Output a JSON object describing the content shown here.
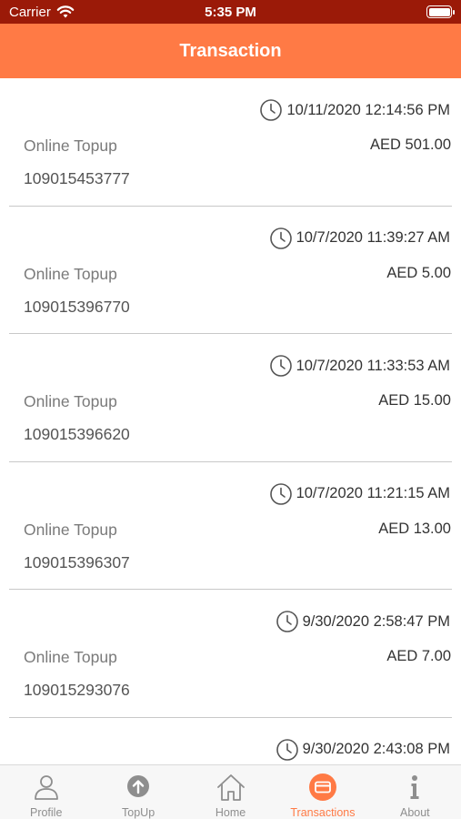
{
  "status_bar": {
    "carrier": "Carrier",
    "time": "5:35 PM"
  },
  "header": {
    "title": "Transaction"
  },
  "transactions": [
    {
      "datetime": "10/11/2020 12:14:56 PM",
      "type": "Online Topup",
      "amount": "AED 501.00",
      "reference": "109015453777"
    },
    {
      "datetime": "10/7/2020 11:39:27 AM",
      "type": "Online Topup",
      "amount": "AED 5.00",
      "reference": "109015396770"
    },
    {
      "datetime": "10/7/2020 11:33:53 AM",
      "type": "Online Topup",
      "amount": "AED 15.00",
      "reference": "109015396620"
    },
    {
      "datetime": "10/7/2020 11:21:15 AM",
      "type": "Online Topup",
      "amount": "AED 13.00",
      "reference": "109015396307"
    },
    {
      "datetime": "9/30/2020 2:58:47 PM",
      "type": "Online Topup",
      "amount": "AED 7.00",
      "reference": "109015293076"
    },
    {
      "datetime": "9/30/2020 2:43:08 PM",
      "type": "",
      "amount": "",
      "reference": ""
    }
  ],
  "tab_bar": {
    "tabs": [
      {
        "label": "Profile",
        "icon": "person-icon"
      },
      {
        "label": "TopUp",
        "icon": "arrow-up-circle-icon"
      },
      {
        "label": "Home",
        "icon": "home-icon"
      },
      {
        "label": "Transactions",
        "icon": "card-icon",
        "active": true
      },
      {
        "label": "About",
        "icon": "info-icon"
      }
    ]
  },
  "colors": {
    "accent": "#ff7a45",
    "status_bar": "#9b1a08",
    "inactive": "#8e8e8e"
  }
}
